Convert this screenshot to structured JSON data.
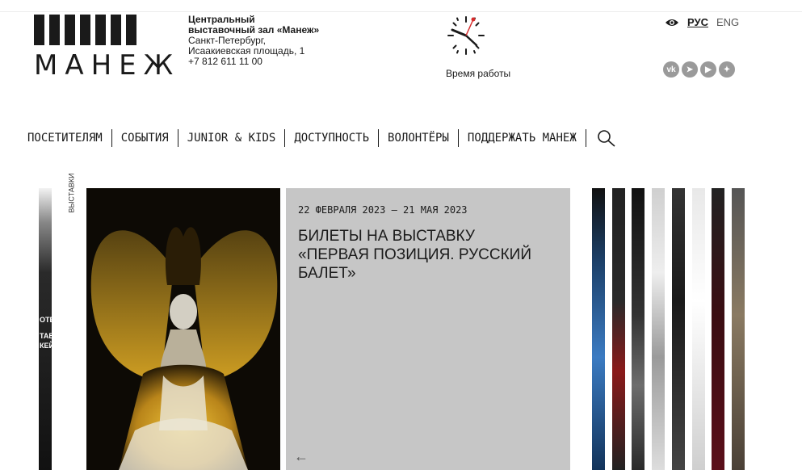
{
  "logo": {
    "word": "МАНЕЖ"
  },
  "address": {
    "line1": "Центральный",
    "line2": "выставочный зал «Манеж»",
    "line3": "Санкт-Петербург,",
    "line4": "Исаакиевская площадь, 1",
    "phone": "+7 812 611 11 00"
  },
  "clock": {
    "label": "Время работы"
  },
  "lang": {
    "rus": "РУС",
    "eng": "ENG"
  },
  "social": [
    {
      "name": "vk-icon",
      "glyph": "vk"
    },
    {
      "name": "telegram-icon",
      "glyph": "➤"
    },
    {
      "name": "youtube-icon",
      "glyph": "▶"
    },
    {
      "name": "dzen-icon",
      "glyph": "✦"
    }
  ],
  "nav": [
    "ПОСЕТИТЕЛЯМ",
    "СОБЫТИЯ",
    "JUNIOR & KIDS",
    "ДОСТУПНОСТЬ",
    "ВОЛОНТЁРЫ",
    "ПОДДЕРЖАТЬ МАНЕЖ"
  ],
  "side_label": "ВЫСТАВКИ",
  "left_sliver_text": [
    "ОТЕ",
    "ТАВ",
    "КЕЙ"
  ],
  "event": {
    "dates": "22 ФЕВРАЛЯ 2023 — 21 МАЯ 2023",
    "title": "Билеты на выставку «Первая позиция. Русский балет»",
    "prev_arrow": "←"
  },
  "colors": {
    "panel": "#c6c6c6",
    "photo_accent": "#e0a81c",
    "text": "#1a1a1a"
  }
}
